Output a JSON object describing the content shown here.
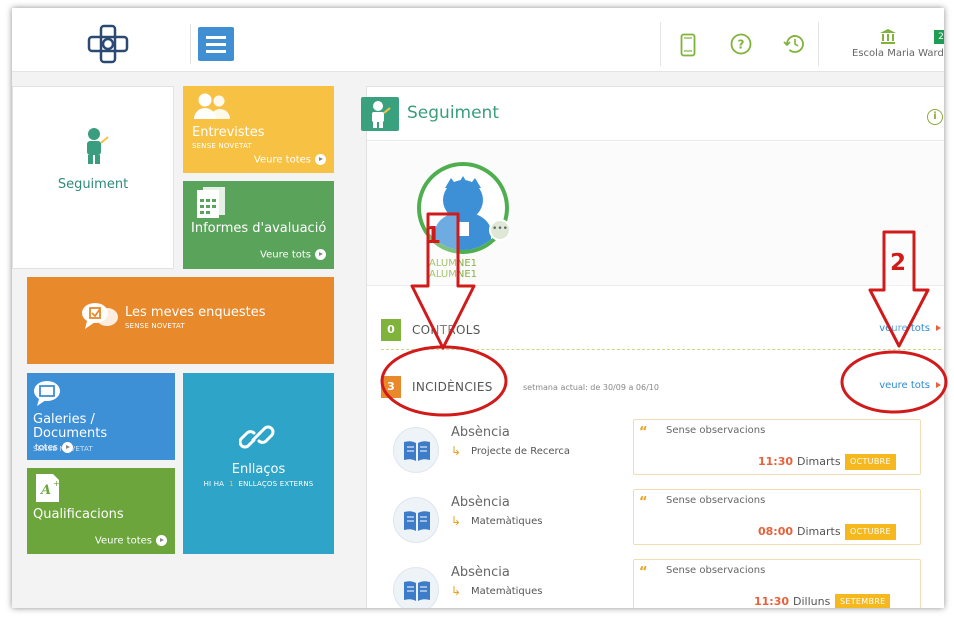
{
  "header": {
    "school_name": "Escola Maria Ward",
    "notification_count": "2",
    "icons": [
      "menu-icon",
      "tablet-icon",
      "help-icon",
      "history-icon",
      "school-icon"
    ]
  },
  "tiles": {
    "seguiment": {
      "label": "Seguiment"
    },
    "entrevistes": {
      "title": "Entrevistes",
      "status": "SENSE NOVETAT",
      "more": "Veure totes"
    },
    "informes": {
      "title": "Informes d'avaluació",
      "more": "Veure tots"
    },
    "enquestes": {
      "title": "Les meves enquestes",
      "status": "SENSE NOVETAT"
    },
    "galeries": {
      "title_line1": "Galeries /",
      "title_line2": "Documents",
      "status": "SENSE NOVETAT",
      "more": "totes"
    },
    "enllacos": {
      "title": "Enllaços",
      "sub_prefix": "HI HA",
      "sub_count": "1",
      "sub_suffix": "ENLLAÇOS EXTERNS"
    },
    "qualificacions": {
      "title": "Qualificacions",
      "more": "Veure totes"
    }
  },
  "panel": {
    "title": "Seguiment",
    "student_line1": "ALUMNE1",
    "student_line2": "ALUMNE1",
    "controls": {
      "count": "0",
      "title": "CONTROLS",
      "more": "veure tots"
    },
    "incidencies": {
      "count": "3",
      "title": "INCIDÈNCIES",
      "subtitle": "setmana actual: de 30/09 a 06/10",
      "more": "veure tots"
    },
    "items": [
      {
        "type": "Absència",
        "subject": "Projecte de Recerca",
        "observation": "Sense observacions",
        "time": "11:30",
        "day": "Dimarts",
        "month": "OCTUBRE"
      },
      {
        "type": "Absència",
        "subject": "Matemàtiques",
        "observation": "Sense observacions",
        "time": "08:00",
        "day": "Dimarts",
        "month": "OCTUBRE"
      },
      {
        "type": "Absència",
        "subject": "Matemàtiques",
        "observation": "Sense observacions",
        "time": "11:30",
        "day": "Dilluns",
        "month": "SETEMBRE"
      }
    ]
  },
  "annotations": {
    "label1": "1",
    "label2": "2",
    "color": "#d11a1a"
  },
  "colors": {
    "seguiment_green": "#3a9d7d",
    "entrevistes": "#f7c244",
    "informes": "#5aa35a",
    "enquestes": "#e8892c",
    "galeries": "#3d8fd6",
    "enllacos": "#2ea4c9",
    "qualificacions": "#6ba53c"
  }
}
